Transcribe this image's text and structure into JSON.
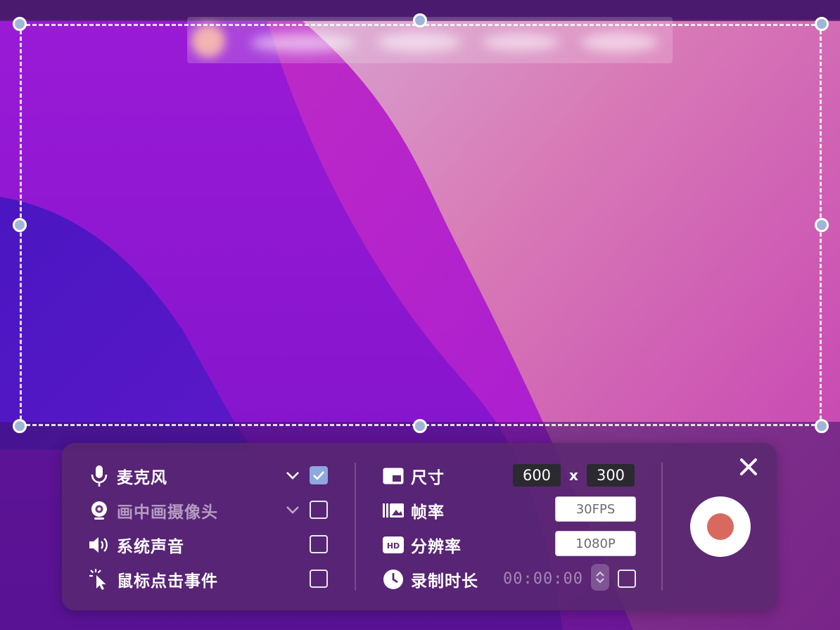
{
  "toolbar": {
    "left_options": [
      {
        "label": "麦克风",
        "icon": "microphone-icon",
        "has_dropdown": true,
        "checked": true,
        "dimmed": false
      },
      {
        "label": "画中画摄像头",
        "icon": "webcam-icon",
        "has_dropdown": true,
        "checked": false,
        "dimmed": true
      },
      {
        "label": "系统声音",
        "icon": "speaker-icon",
        "has_dropdown": false,
        "checked": false,
        "dimmed": false
      },
      {
        "label": "鼠标点击事件",
        "icon": "cursor-click-icon",
        "has_dropdown": false,
        "checked": false,
        "dimmed": false
      }
    ],
    "size": {
      "label": "尺寸",
      "icon": "size-icon",
      "width": "600",
      "separator": "x",
      "height": "300"
    },
    "framerate": {
      "label": "帧率",
      "icon": "framerate-icon",
      "value": "30FPS"
    },
    "resolution": {
      "label": "分辨率",
      "icon": "hd-icon",
      "value": "1080P"
    },
    "duration": {
      "label": "录制时长",
      "icon": "clock-icon",
      "value": "00:00:00",
      "checked": false
    },
    "close_icon": "close-icon",
    "record_icon": "record-icon"
  },
  "colors": {
    "panel_bg": "#58286e",
    "checkbox_checked": "#8ea7df",
    "record_dot": "#d9695f",
    "handle": "#9fb6d8"
  }
}
